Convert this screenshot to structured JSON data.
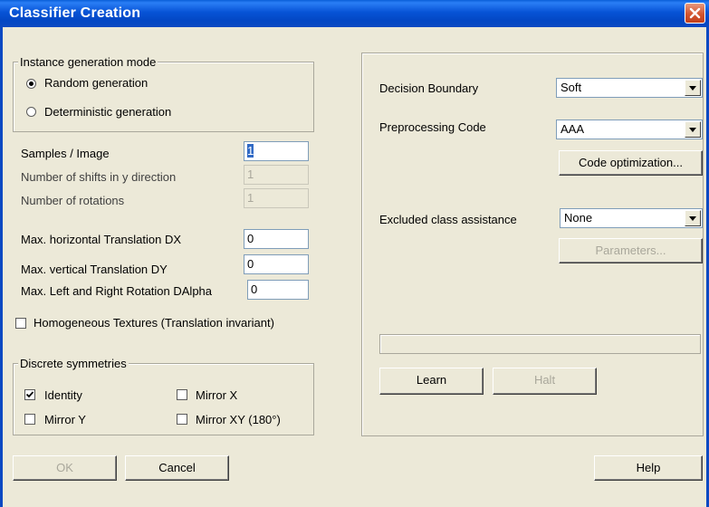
{
  "window": {
    "title": "Classifier Creation"
  },
  "instance_mode": {
    "legend": "Instance generation mode",
    "options": [
      "Random generation",
      "Deterministic generation"
    ],
    "selected": "Random generation"
  },
  "params": {
    "samples_label": "Samples / Image",
    "samples_value": "1",
    "shifts_label": "Number of shifts in y direction",
    "shifts_value": "1",
    "rotations_label": "Number of rotations",
    "rotations_value": "1",
    "dx_label": "Max. horizontal Translation DX",
    "dx_value": "0",
    "dy_label": "Max. vertical Translation DY",
    "dy_value": "0",
    "dalpha_label": "Max. Left and Right Rotation DAlpha",
    "dalpha_value": "0"
  },
  "homogeneous": {
    "label": "Homogeneous Textures (Translation invariant)",
    "checked": false
  },
  "symmetries": {
    "legend": "Discrete symmetries",
    "identity": "Identity",
    "mirror_x": "Mirror X",
    "mirror_y": "Mirror Y",
    "mirror_xy": "Mirror XY (180°)"
  },
  "right": {
    "decision_label": "Decision Boundary",
    "decision_value": "Soft",
    "preproc_label": "Preprocessing Code",
    "preproc_value": "AAA",
    "code_opt_button": "Code optimization...",
    "excluded_label": "Excluded class assistance",
    "excluded_value": "None",
    "parameters_button": "Parameters...",
    "learn_button": "Learn",
    "halt_button": "Halt"
  },
  "footer": {
    "ok_button": "OK",
    "cancel_button": "Cancel",
    "help_button": "Help"
  },
  "icons": {
    "close": "close-icon",
    "check": "checkmark-icon"
  }
}
